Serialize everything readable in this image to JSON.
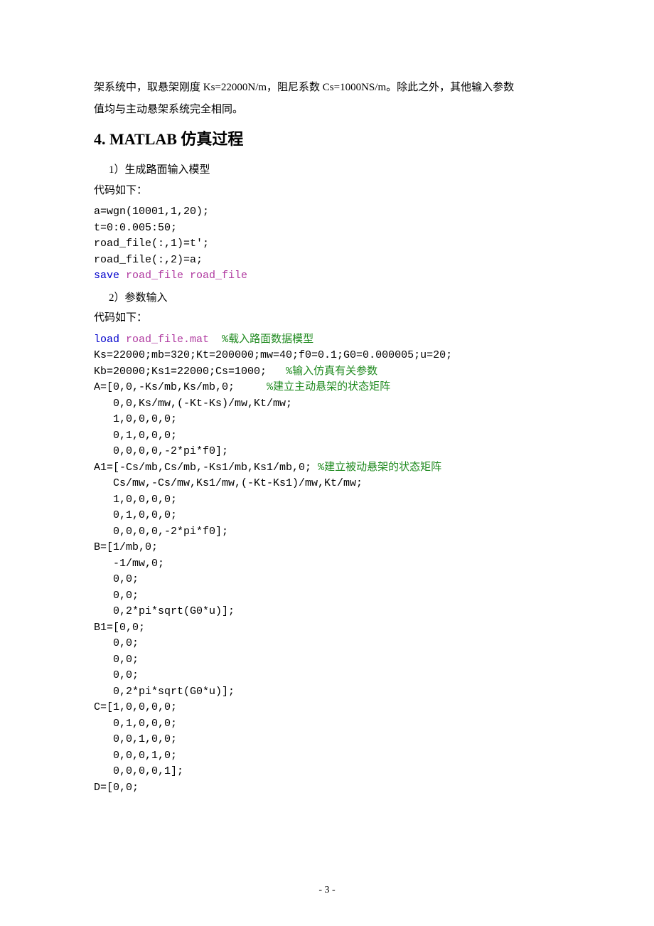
{
  "intro": {
    "line1": "架系统中，取悬架刚度 Ks=22000N/m，阻尼系数 Cs=1000NS/m。除此之外，其他输入参数",
    "line2": "值均与主动悬架系统完全相同。"
  },
  "heading": "4.  MATLAB 仿真过程",
  "step1": "1）生成路面输入模型",
  "code_label": "代码如下：",
  "code1": {
    "l1": "a=wgn(10001,1,20);",
    "l2": "t=0:0.005:50;",
    "l3": "road_file(:,1)=t';",
    "l4": "road_file(:,2)=a;",
    "l5_kw": "save",
    "l5_args": "road_file road_file"
  },
  "step2": "2）参数输入",
  "code2": {
    "l1_kw": "load",
    "l1_arg": "road_file.mat",
    "l1_com": "%载入路面数据模型",
    "l2": "Ks=22000;mb=320;Kt=200000;mw=40;f0=0.1;G0=0.000005;u=20;",
    "l3_a": "Kb=20000;Ks1=22000;Cs=1000;",
    "l3_com": "%输入仿真有关参数",
    "l4_a": "A=[0,0,-Ks/mb,Ks/mb,0;",
    "l4_com": "%建立主动悬架的状态矩阵",
    "l5": "   0,0,Ks/mw,(-Kt-Ks)/mw,Kt/mw;",
    "l6": "   1,0,0,0,0;",
    "l7": "   0,1,0,0,0;",
    "l8": "   0,0,0,0,-2*pi*f0];",
    "l9_a": "A1=[-Cs/mb,Cs/mb,-Ks1/mb,Ks1/mb,0;",
    "l9_com": "%建立被动悬架的状态矩阵",
    "l10": "   Cs/mw,-Cs/mw,Ks1/mw,(-Kt-Ks1)/mw,Kt/mw;",
    "l11": "   1,0,0,0,0;",
    "l12": "   0,1,0,0,0;",
    "l13": "   0,0,0,0,-2*pi*f0];",
    "l14": "B=[1/mb,0;",
    "l15": "   -1/mw,0;",
    "l16": "   0,0;",
    "l17": "   0,0;",
    "l18": "   0,2*pi*sqrt(G0*u)];",
    "l19": "B1=[0,0;",
    "l20": "   0,0;",
    "l21": "   0,0;",
    "l22": "   0,0;",
    "l23": "   0,2*pi*sqrt(G0*u)];",
    "l24": "C=[1,0,0,0,0;",
    "l25": "   0,1,0,0,0;",
    "l26": "   0,0,1,0,0;",
    "l27": "   0,0,0,1,0;",
    "l28": "   0,0,0,0,1];",
    "l29": "D=[0,0;"
  },
  "page_number": "- 3 -"
}
